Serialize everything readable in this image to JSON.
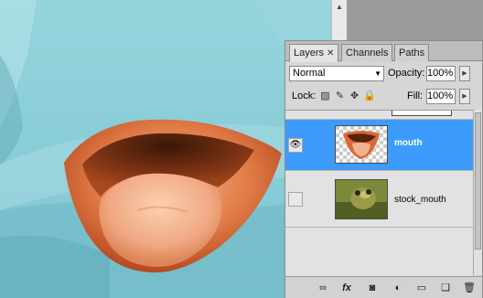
{
  "canvas": {
    "background_color": "#7cc3cf",
    "content": "mouth-image"
  },
  "panel": {
    "tabs": [
      {
        "label": "Layers",
        "active": true,
        "closable": true
      },
      {
        "label": "Channels",
        "active": false
      },
      {
        "label": "Paths",
        "active": false
      }
    ],
    "blend_mode": "Normal",
    "opacity_label": "Opacity:",
    "opacity_value": "100%",
    "lock_label": "Lock:",
    "fill_label": "Fill:",
    "fill_value": "100%",
    "layers": [
      {
        "name": "mouth",
        "selected": true,
        "visible": true
      },
      {
        "name": "stock_mouth",
        "selected": false,
        "visible": false
      }
    ],
    "bottom_icons": [
      "link-layers-icon",
      "fx-icon",
      "layer-mask-icon",
      "adjustment-layer-icon",
      "new-group-icon",
      "new-layer-icon",
      "delete-layer-icon"
    ],
    "fx_label": "fx",
    "selection_color": "#3d9bfc"
  }
}
